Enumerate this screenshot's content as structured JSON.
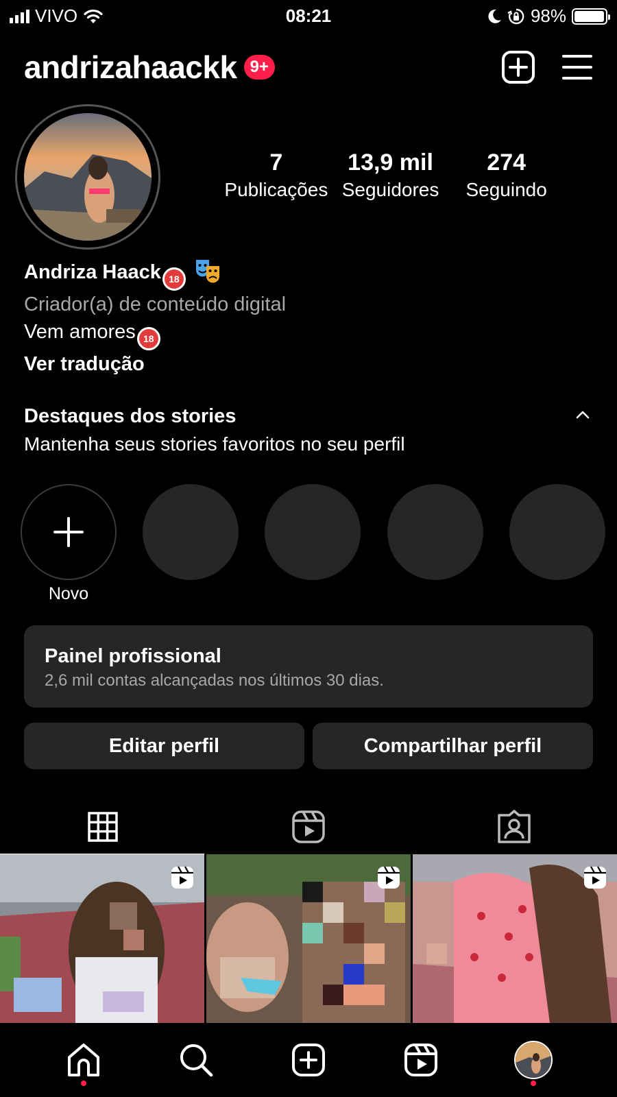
{
  "status_bar": {
    "carrier": "VIVO",
    "time": "08:21",
    "battery_text": "98%",
    "battery_level": 0.98,
    "icons": [
      "signal-icon",
      "wifi-icon",
      "moon-icon",
      "rotation-lock-icon",
      "battery-icon"
    ]
  },
  "header": {
    "username": "andrizahaackk",
    "notification_badge": "9+",
    "icons": [
      "new-post-icon",
      "menu-icon"
    ]
  },
  "profile": {
    "stats": [
      {
        "value": "7",
        "label": "Publicações"
      },
      {
        "value": "13,9 mil",
        "label": "Seguidores"
      },
      {
        "value": "274",
        "label": "Seguindo"
      }
    ],
    "name": "Andriza Haack",
    "category": "Criador(a) de conteúdo digital",
    "bio_line": "Vem amores",
    "translate": "Ver tradução",
    "emoji_18": "18"
  },
  "highlights": {
    "title": "Destaques dos stories",
    "subtitle": "Mantenha seus stories favoritos no seu perfil",
    "new_label": "Novo"
  },
  "panel": {
    "title": "Painel profissional",
    "subtitle": "2,6 mil contas alcançadas nos últimos 30 dias."
  },
  "actions": {
    "edit": "Editar perfil",
    "share": "Compartilhar perfil"
  },
  "tabs": [
    "grid-icon",
    "reels-icon",
    "tagged-icon"
  ],
  "bottom_nav": [
    "home-icon",
    "search-icon",
    "create-icon",
    "reels-icon",
    "profile-avatar"
  ],
  "colors": {
    "background": "#000000",
    "surface": "#262626",
    "badge": "#ff1f4a",
    "secondary_text": "#a8a8a8"
  }
}
